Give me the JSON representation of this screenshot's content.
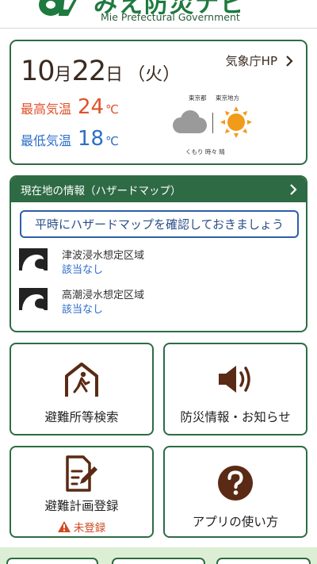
{
  "header": {
    "title": "みえ防災ナビ",
    "subtitle": "Mie Prefectural Government"
  },
  "weather": {
    "month": "10",
    "month_unit": "月",
    "day": "22",
    "day_unit": "日",
    "weekday": "（火）",
    "jma_link": "気象庁HP",
    "high_label": "最高気温",
    "high_value": "24",
    "low_label": "最低気温",
    "low_value": "18",
    "temp_unit": "℃",
    "forecast_region_1": "東京都",
    "forecast_region_2": "東京地方",
    "forecast_text": "くもり 時々 晴",
    "high_color": "#e0502a",
    "low_color": "#2d6fc7"
  },
  "hazard": {
    "header": "現在地の情報（ハザードマップ）",
    "check_button": "平時にハザードマップを確認しておきましょう",
    "items": [
      {
        "name": "津波浸水想定区域",
        "status": "該当なし"
      },
      {
        "name": "高潮浸水想定区域",
        "status": "該当なし"
      }
    ]
  },
  "menu": {
    "shelter_search": "避難所等検索",
    "disaster_info": "防災情報・お知らせ",
    "evac_plan": "避難計画登録",
    "evac_plan_status": "未登録",
    "how_to_use": "アプリの使い方"
  },
  "colors": {
    "brand_green": "#2e6b44",
    "icon_brown": "#5a2a14",
    "warning": "#d04a22",
    "link_blue": "#2a6ccc"
  }
}
